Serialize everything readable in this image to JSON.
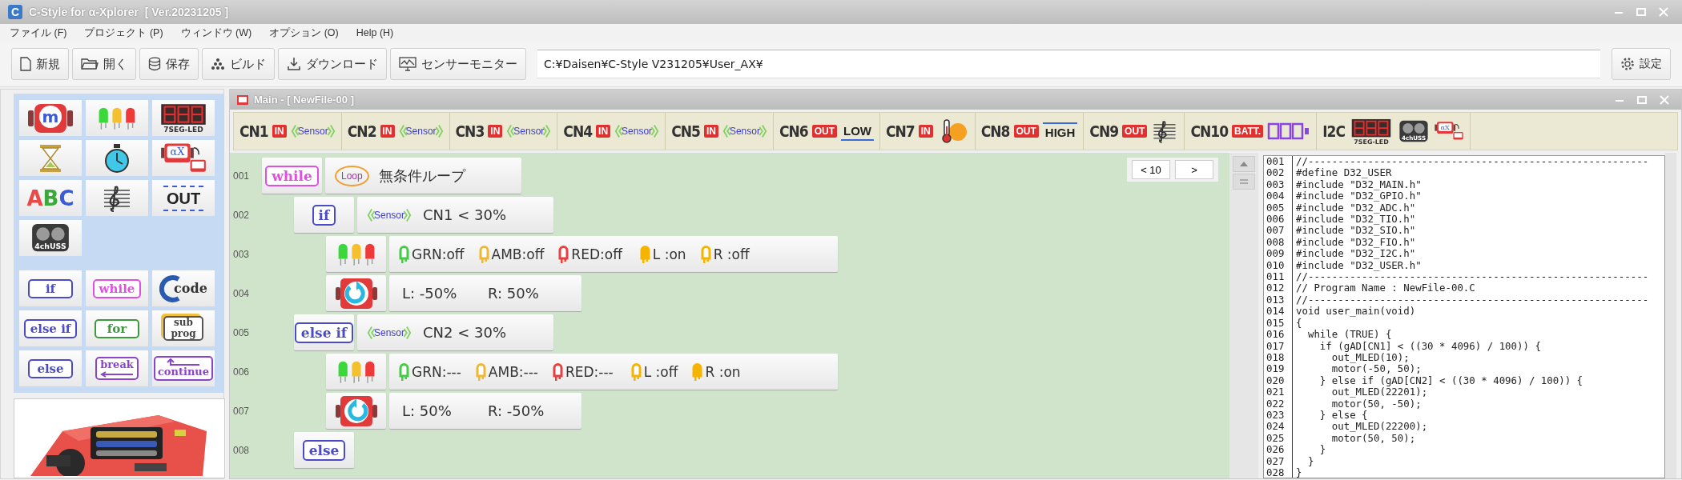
{
  "window": {
    "app_icon": "C",
    "title": "C-Style for α-Xplorer  [ Ver.20231205 ]"
  },
  "menu": [
    "ファイル (F)",
    "プロジェクト (P)",
    "ウィンドウ (W)",
    "オプション (O)",
    "Help (H)"
  ],
  "toolbar": {
    "buttons": [
      {
        "kind": "new",
        "label": "新規"
      },
      {
        "kind": "open",
        "label": "開く"
      },
      {
        "kind": "save",
        "label": "保存"
      },
      {
        "kind": "build",
        "label": "ビルド"
      },
      {
        "kind": "download",
        "label": "ダウンロード"
      },
      {
        "kind": "monitor",
        "label": "センサーモニター"
      }
    ],
    "path": "C:¥Daisen¥C-Style V231205¥User_AX¥",
    "settings": {
      "kind": "settings",
      "label": "設定"
    }
  },
  "palette": {
    "devices": [
      {
        "kind": "motor",
        "text": "m"
      },
      {
        "kind": "leds"
      },
      {
        "kind": "sevenseg",
        "text": "7SEG-LED"
      },
      {
        "kind": "hourglass"
      },
      {
        "kind": "stopwatch"
      },
      {
        "kind": "ax",
        "text": "αX"
      },
      {
        "kind": "abc",
        "text": "ABC"
      },
      {
        "kind": "score"
      },
      {
        "kind": "out",
        "text": "OUT"
      },
      {
        "kind": "uss",
        "text": "4chUSS"
      }
    ],
    "controls": [
      {
        "kind": "keyword",
        "text": "if",
        "color": "#4b4bc8"
      },
      {
        "kind": "keyword",
        "text": "while",
        "color": "#e050e0"
      },
      {
        "kind": "code",
        "text": "code",
        "color": "#333333"
      },
      {
        "kind": "keyword",
        "text": "else if",
        "color": "#4b4bc8"
      },
      {
        "kind": "keyword",
        "text": "for",
        "color": "#3c9a3c"
      },
      {
        "kind": "subprog",
        "text": "sub prog",
        "color": "#444444"
      },
      {
        "kind": "keyword",
        "text": "else",
        "color": "#4b4bc8"
      },
      {
        "kind": "break",
        "text": "break",
        "color": "#8a44c8"
      },
      {
        "kind": "continue",
        "text": "continue",
        "color": "#8a44c8"
      }
    ]
  },
  "main_window": {
    "title": "Main - [ NewFile-00 ]",
    "ports": [
      {
        "port": "CN1",
        "mode": "IN",
        "devices": [
          {
            "kind": "sensor",
            "text": "Sensor"
          }
        ]
      },
      {
        "port": "CN2",
        "mode": "IN",
        "devices": [
          {
            "kind": "sensor",
            "text": "Sensor"
          }
        ]
      },
      {
        "port": "CN3",
        "mode": "IN",
        "devices": [
          {
            "kind": "sensor",
            "text": "Sensor"
          }
        ]
      },
      {
        "port": "CN4",
        "mode": "IN",
        "devices": [
          {
            "kind": "sensor",
            "text": "Sensor"
          }
        ]
      },
      {
        "port": "CN5",
        "mode": "IN",
        "devices": [
          {
            "kind": "sensor",
            "text": "Sensor"
          }
        ]
      },
      {
        "port": "CN6",
        "mode": "OUT",
        "devices": [
          {
            "kind": "low",
            "text": "LOW"
          }
        ]
      },
      {
        "port": "CN7",
        "mode": "IN",
        "devices": [
          {
            "kind": "thermometer"
          }
        ]
      },
      {
        "port": "CN8",
        "mode": "OUT",
        "devices": [
          {
            "kind": "high",
            "text": "HIGH"
          }
        ]
      },
      {
        "port": "CN9",
        "mode": "OUT",
        "devices": [
          {
            "kind": "score"
          }
        ]
      },
      {
        "port": "CN10",
        "mode": "BATT.",
        "devices": [
          {
            "kind": "battery"
          }
        ]
      },
      {
        "port": "I2C",
        "devices": [
          {
            "kind": "sevenseg",
            "text": "7SEG-LED"
          },
          {
            "kind": "uss",
            "text": "4chUSS"
          },
          {
            "kind": "ax",
            "text": "αX"
          }
        ]
      }
    ],
    "program": {
      "pager": {
        "previous": "< 10",
        "next": ">"
      },
      "rows": [
        {
          "no": "001",
          "kind": "while",
          "keyword": "while",
          "color": "#e050e0",
          "icon": "Loop",
          "text": "無条件ループ",
          "children": [
            {
              "no": "002",
              "kind": "condition",
              "keyword": "if",
              "color": "#4b4bc8",
              "icon": "Sensor",
              "text": "CN1 < 30%",
              "children": [
                {
                  "no": "003",
                  "kind": "led",
                  "leds": [
                    {
                      "label": "GRN:off",
                      "color": "#44cc44",
                      "on": false
                    },
                    {
                      "label": "AMB:off",
                      "color": "#f0b830",
                      "on": false
                    },
                    {
                      "label": "RED:off",
                      "color": "#e84040",
                      "on": false
                    },
                    {
                      "label": "L :on",
                      "color": "#f5b400",
                      "on": true
                    },
                    {
                      "label": "R :off",
                      "color": "#f5b400",
                      "on": false
                    }
                  ]
                },
                {
                  "no": "004",
                  "kind": "motor",
                  "clockwise": false,
                  "left": "L: -50%",
                  "right": "R: 50%"
                }
              ]
            },
            {
              "no": "005",
              "kind": "condition",
              "keyword": "else if",
              "color": "#4b4bc8",
              "icon": "Sensor",
              "text": "CN2 < 30%",
              "children": [
                {
                  "no": "006",
                  "kind": "led",
                  "leds": [
                    {
                      "label": "GRN:---",
                      "color": "#44cc44",
                      "on": false
                    },
                    {
                      "label": "AMB:---",
                      "color": "#f0b830",
                      "on": false
                    },
                    {
                      "label": "RED:---",
                      "color": "#e84040",
                      "on": false
                    },
                    {
                      "label": "L :off",
                      "color": "#f5b400",
                      "on": false
                    },
                    {
                      "label": "R :on",
                      "color": "#f5b400",
                      "on": true
                    }
                  ]
                },
                {
                  "no": "007",
                  "kind": "motor",
                  "clockwise": true,
                  "left": "L: 50%",
                  "right": "R: -50%"
                }
              ]
            },
            {
              "no": "008",
              "kind": "else",
              "keyword": "else",
              "color": "#4b4bc8"
            }
          ]
        }
      ]
    },
    "code": {
      "lines": [
        {
          "no": "001",
          "text": "//---------------------------------------------------------"
        },
        {
          "no": "002",
          "text": "#define D32_USER"
        },
        {
          "no": "003",
          "text": "#include \"D32_MAIN.h\""
        },
        {
          "no": "004",
          "text": "#include \"D32_GPIO.h\""
        },
        {
          "no": "005",
          "text": "#include \"D32_ADC.h\""
        },
        {
          "no": "006",
          "text": "#include \"D32_TIO.h\""
        },
        {
          "no": "007",
          "text": "#include \"D32_SIO.h\""
        },
        {
          "no": "008",
          "text": "#include \"D32_FIO.h\""
        },
        {
          "no": "009",
          "text": "#include \"D32_I2C.h\""
        },
        {
          "no": "010",
          "text": "#include \"D32_USER.h\""
        },
        {
          "no": "011",
          "text": "//---------------------------------------------------------"
        },
        {
          "no": "012",
          "text": "// Program Name : NewFile-00.C"
        },
        {
          "no": "013",
          "text": "//---------------------------------------------------------"
        },
        {
          "no": "014",
          "text": "void user_main(void)"
        },
        {
          "no": "015",
          "text": "{"
        },
        {
          "no": "016",
          "text": "  while (TRUE) {"
        },
        {
          "no": "017",
          "text": "    if (gAD[CN1] < ((30 * 4096) / 100)) {"
        },
        {
          "no": "018",
          "text": "      out_MLED(10);"
        },
        {
          "no": "019",
          "text": "      motor(-50, 50);"
        },
        {
          "no": "020",
          "text": "    } else if (gAD[CN2] < ((30 * 4096) / 100)) {"
        },
        {
          "no": "021",
          "text": "      out_MLED(22201);"
        },
        {
          "no": "022",
          "text": "      motor(50, -50);"
        },
        {
          "no": "023",
          "text": "    } else {"
        },
        {
          "no": "024",
          "text": "      out_MLED(22200);"
        },
        {
          "no": "025",
          "text": "      motor(50, 50);"
        },
        {
          "no": "026",
          "text": "    }"
        },
        {
          "no": "027",
          "text": "  }"
        },
        {
          "no": "028",
          "text": "}"
        }
      ]
    }
  }
}
